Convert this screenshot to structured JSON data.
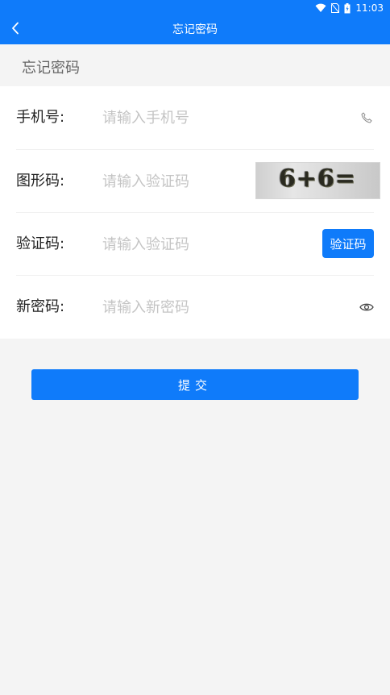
{
  "status_bar": {
    "time": "11:03"
  },
  "nav": {
    "title": "忘记密码",
    "back_icon": "chevron-left-icon"
  },
  "section": {
    "title": "忘记密码"
  },
  "form": {
    "phone": {
      "label": "手机号:",
      "placeholder": "请输入手机号",
      "icon": "phone-icon"
    },
    "captcha": {
      "label": "图形码:",
      "placeholder": "请输入验证码",
      "image_text": "6+6="
    },
    "sms_code": {
      "label": "验证码:",
      "placeholder": "请输入验证码",
      "button": "验证码"
    },
    "new_password": {
      "label": "新密码:",
      "placeholder": "请输入新密码",
      "icon": "eye-icon"
    }
  },
  "submit": {
    "label": "提交"
  },
  "colors": {
    "primary": "#0f7bfa",
    "background": "#f4f4f4"
  }
}
